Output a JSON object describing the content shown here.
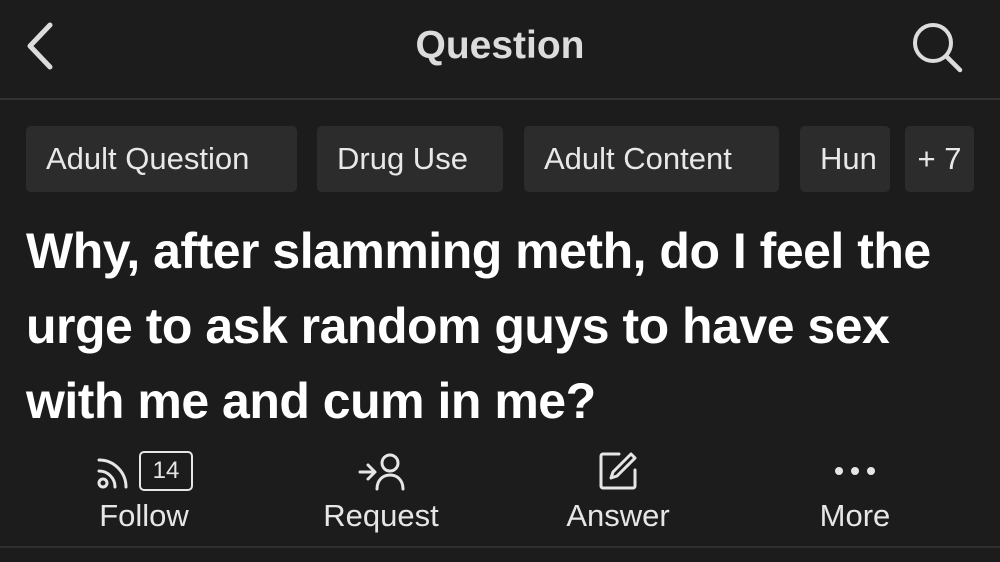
{
  "header": {
    "title": "Question",
    "back_icon": "chevron-left-icon",
    "search_icon": "search-icon"
  },
  "topics": {
    "items": [
      {
        "label": "Adult Question"
      },
      {
        "label": "Drug Use"
      },
      {
        "label": "Adult Content"
      },
      {
        "label": "Hun"
      }
    ],
    "more_label": "+ 7"
  },
  "question": {
    "text": "Why, after slamming meth, do I feel the urge to ask random guys to have sex with me and cum in me?"
  },
  "actions": {
    "follow": {
      "label": "Follow",
      "count": "14",
      "icon": "follow-icon"
    },
    "request": {
      "label": "Request",
      "icon": "request-icon"
    },
    "answer": {
      "label": "Answer",
      "icon": "pencil-icon"
    },
    "more": {
      "label": "More",
      "icon": "more-dots-icon"
    }
  },
  "colors": {
    "background": "#1c1c1c",
    "chip_background": "#2c2c2c",
    "text": "#ffffff"
  }
}
